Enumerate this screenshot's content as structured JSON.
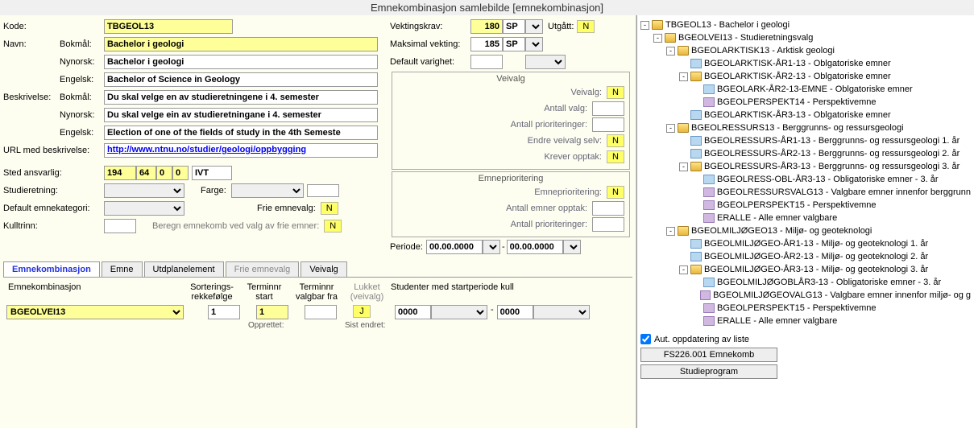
{
  "title": "Emnekombinasjon samlebilde  [emnekombinasjon]",
  "labels": {
    "kode": "Kode:",
    "navn": "Navn:",
    "bokmal": "Bokmål:",
    "nynorsk": "Nynorsk:",
    "engelsk": "Engelsk:",
    "beskrivelse": "Beskrivelse:",
    "url": "URL med beskrivelse:",
    "sted": "Sted ansvarlig:",
    "studieretning": "Studieretning:",
    "default_emnekat": "Default emnekategori:",
    "kulltrinn": "Kulltrinn:",
    "farge": "Farge:",
    "frie_emnevalg": "Frie emnevalg:",
    "beregn": "Beregn emnekomb ved valg av frie emner:",
    "vektingskrav": "Vektingskrav:",
    "maksimal": "Maksimal vekting:",
    "default_varighet": "Default varighet:",
    "veivalg_head": "Veivalg",
    "veivalg": "Veivalg:",
    "antall_valg": "Antall valg:",
    "antall_prio": "Antall prioriteringer:",
    "endre_selv": "Endre veivalg selv:",
    "krever_opptak": "Krever opptak:",
    "emnepri_head": "Emneprioritering",
    "emnepri": "Emneprioritering:",
    "antall_emner": "Antall emner opptak:",
    "periode": "Periode:",
    "utgatt": "Utgått:",
    "opprettet_v": "Opprettet:",
    "sist_endret_v": "Sist endret:",
    "emnekombinasjon": "Emnekombinasjon",
    "sorterings": "Sorterings-\nrekkefølge",
    "terminnr_start": "Terminnr\nstart",
    "terminnr_valgbar": "Terminnr\nvalgbar fra",
    "lukket": "Lukket\n(veivalg)",
    "studenter": "Studenter med startperiode kull",
    "opprettet": "Opprettet:",
    "sist_endret": "Sist endret:",
    "aut_opp": "Aut. oppdatering av liste"
  },
  "values": {
    "kode": "TBGEOL13",
    "navn_bokmal": "Bachelor i geologi",
    "navn_nynorsk": "Bachelor i geologi",
    "navn_engelsk": "Bachelor of Science in Geology",
    "besk_bokmal": "Du skal velge en av studieretningene i 4. semester",
    "besk_nynorsk": "Du skal velge ein av studieretningane i 4. semester",
    "besk_engelsk": "Election of one of the fields of study in the 4th Semeste",
    "url": "http://www.ntnu.no/studier/geologi/oppbygging",
    "sted1": "194",
    "sted2": "64",
    "sted3": "0",
    "sted4": "0",
    "sted5": "IVT",
    "vektingskrav": "180",
    "vek_unit": "SP",
    "maksimal": "185",
    "maks_unit": "SP",
    "utgatt": "N",
    "veivalg": "N",
    "endre_selv": "N",
    "krever_opptak": "N",
    "emnepri": "N",
    "frie_emnevalg": "N",
    "beregn": "N",
    "periode1": "00.00.0000",
    "periode2": "00.00.0000",
    "ek_row": "BGEOLVEI13",
    "sort": "1",
    "term_start": "1",
    "lukket": "J",
    "stud1": "0000",
    "stud2": "0000"
  },
  "tabs": [
    "Emnekombinasjon",
    "Emne",
    "Utdplanelement",
    "Frie emnevalg",
    "Veivalg"
  ],
  "buttons": {
    "fs226": "FS226.001 Emnekomb",
    "studieprogram": "Studieprogram"
  },
  "tree": [
    {
      "indent": 0,
      "toggle": "-",
      "icon": "folder",
      "label": "TBGEOL13 - Bachelor i geologi"
    },
    {
      "indent": 1,
      "toggle": "-",
      "icon": "folder",
      "label": "BGEOLVEI13 - Studieretningsvalg"
    },
    {
      "indent": 2,
      "toggle": "-",
      "icon": "folder",
      "label": "BGEOLARKTISK13 - Arktisk geologi"
    },
    {
      "indent": 3,
      "toggle": "",
      "icon": "leaf1",
      "label": "BGEOLARKTISK-ÅR1-13 - Oblgatoriske emner"
    },
    {
      "indent": 3,
      "toggle": "-",
      "icon": "folder",
      "label": "BGEOLARKTISK-ÅR2-13 - Oblgatoriske emner"
    },
    {
      "indent": 4,
      "toggle": "",
      "icon": "leaf1",
      "label": "BGEOLARK-ÅR2-13-EMNE - Oblgatoriske emner"
    },
    {
      "indent": 4,
      "toggle": "",
      "icon": "leaf2",
      "label": "BGEOLPERSPEKT14 - Perspektivemne"
    },
    {
      "indent": 3,
      "toggle": "",
      "icon": "leaf1",
      "label": "BGEOLARKTISK-ÅR3-13 - Oblgatoriske emner"
    },
    {
      "indent": 2,
      "toggle": "-",
      "icon": "folder",
      "label": "BGEOLRESSURS13 - Berggrunns- og ressursgeologi"
    },
    {
      "indent": 3,
      "toggle": "",
      "icon": "leaf1",
      "label": "BGEOLRESSURS-ÅR1-13 - Berggrunns- og ressursgeologi 1. år"
    },
    {
      "indent": 3,
      "toggle": "",
      "icon": "leaf1",
      "label": "BGEOLRESSURS-ÅR2-13 - Berggrunns- og ressursgeologi 2. år"
    },
    {
      "indent": 3,
      "toggle": "-",
      "icon": "folder",
      "label": "BGEOLRESSURS-ÅR3-13 - Berggrunns- og ressursgeologi 3. år"
    },
    {
      "indent": 4,
      "toggle": "",
      "icon": "leaf1",
      "label": "BGEOLRESS-OBL-ÅR3-13 - Obligatoriske emner - 3. år"
    },
    {
      "indent": 4,
      "toggle": "",
      "icon": "leaf2",
      "label": "BGEOLRESSURSVALG13 - Valgbare emner innenfor berggrunn"
    },
    {
      "indent": 4,
      "toggle": "",
      "icon": "leaf2",
      "label": "BGEOLPERSPEKT15 - Perspektivemne"
    },
    {
      "indent": 4,
      "toggle": "",
      "icon": "leaf2",
      "label": "ERALLE - Alle emner valgbare"
    },
    {
      "indent": 2,
      "toggle": "-",
      "icon": "folder",
      "label": "BGEOLMILJØGEO13 - Miljø- og geoteknologi"
    },
    {
      "indent": 3,
      "toggle": "",
      "icon": "leaf1",
      "label": "BGEOLMILJØGEO-ÅR1-13 - Miljø- og geoteknologi 1. år"
    },
    {
      "indent": 3,
      "toggle": "",
      "icon": "leaf1",
      "label": "BGEOLMILJØGEO-ÅR2-13 - Miljø- og geoteknologi 2. år"
    },
    {
      "indent": 3,
      "toggle": "-",
      "icon": "folder",
      "label": "BGEOLMILJØGEO-ÅR3-13 - Miljø- og geoteknologi 3. år"
    },
    {
      "indent": 4,
      "toggle": "",
      "icon": "leaf1",
      "label": "BGEOLMILJØGOBLÅR3-13 - Obligatoriske emner - 3. år"
    },
    {
      "indent": 4,
      "toggle": "",
      "icon": "leaf2",
      "label": "BGEOLMILJØGEOVALG13 - Valgbare emner innenfor miljø- og g"
    },
    {
      "indent": 4,
      "toggle": "",
      "icon": "leaf2",
      "label": "BGEOLPERSPEKT15 - Perspektivemne"
    },
    {
      "indent": 4,
      "toggle": "",
      "icon": "leaf2",
      "label": "ERALLE - Alle emner valgbare"
    }
  ]
}
